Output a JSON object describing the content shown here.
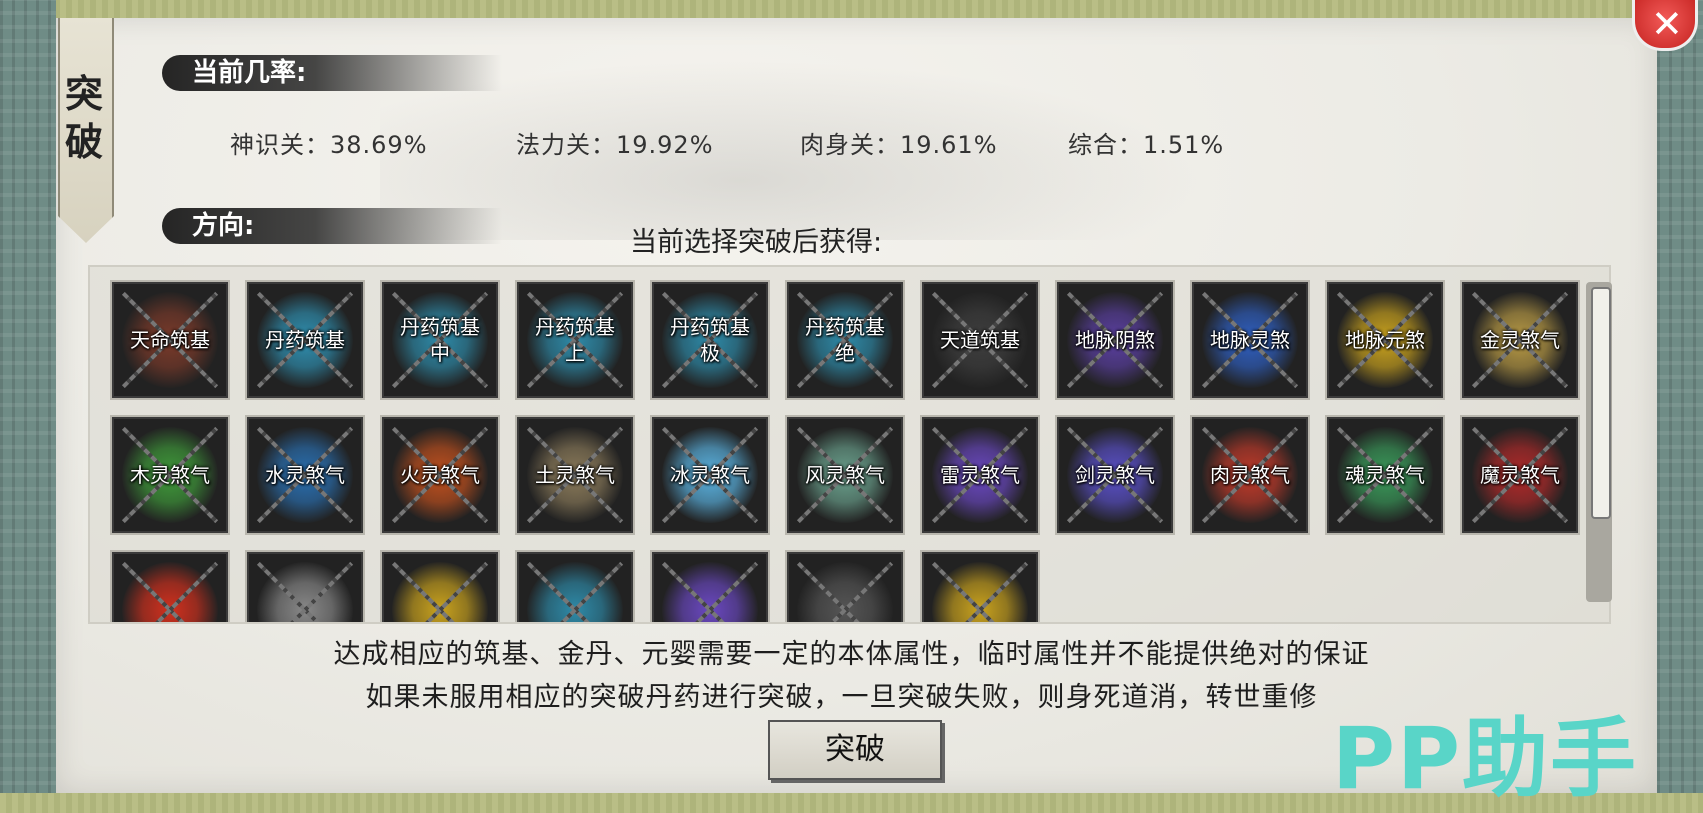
{
  "tab": {
    "label": "突\n破"
  },
  "probability_section": {
    "title": "当前几率:",
    "items": [
      {
        "text": "神识关：38.69%"
      },
      {
        "text": "法力关：19.92%"
      },
      {
        "text": "肉身关：19.61%"
      },
      {
        "text": "综合：1.51%"
      }
    ]
  },
  "direction_section": {
    "title": "方向:",
    "gain_title": "当前选择突破后获得:"
  },
  "items": [
    {
      "label": "天命筑基",
      "color": "#7a3a2a"
    },
    {
      "label": "丹药筑基",
      "color": "#2f8fb0"
    },
    {
      "label": "丹药筑基\n中",
      "color": "#2e8aa8"
    },
    {
      "label": "丹药筑基\n上",
      "color": "#2e8aa8"
    },
    {
      "label": "丹药筑基\n极",
      "color": "#2e8aa8"
    },
    {
      "label": "丹药筑基\n绝",
      "color": "#2e8aa8"
    },
    {
      "label": "天道筑基",
      "color": "#3e3e3e"
    },
    {
      "label": "地脉阴煞",
      "color": "#5a3fa0"
    },
    {
      "label": "地脉灵煞",
      "color": "#2f5fc0"
    },
    {
      "label": "地脉元煞",
      "color": "#c9a21e"
    },
    {
      "label": "金灵煞气",
      "color": "#b89a45"
    },
    {
      "label": "木灵煞气",
      "color": "#3f9a3a"
    },
    {
      "label": "水灵煞气",
      "color": "#2a6fb0"
    },
    {
      "label": "火灵煞气",
      "color": "#c0501e"
    },
    {
      "label": "土灵煞气",
      "color": "#8a7a5a"
    },
    {
      "label": "冰灵煞气",
      "color": "#5ab2e0"
    },
    {
      "label": "风灵煞气",
      "color": "#6aa08c"
    },
    {
      "label": "雷灵煞气",
      "color": "#6a48c0"
    },
    {
      "label": "剑灵煞气",
      "color": "#5a50c8"
    },
    {
      "label": "肉灵煞气",
      "color": "#c03a2a"
    },
    {
      "label": "魂灵煞气",
      "color": "#3a9a5a"
    },
    {
      "label": "魔灵煞气",
      "color": "#b02a2a"
    },
    {
      "label": "",
      "color": "#d0301e"
    },
    {
      "label": "",
      "color": "#888888"
    },
    {
      "label": "",
      "color": "#c9a21e"
    },
    {
      "label": "",
      "color": "#2e8aa8"
    },
    {
      "label": "",
      "color": "#6a48c0"
    },
    {
      "label": "",
      "color": "#555555"
    },
    {
      "label": "",
      "color": "#c9a21e"
    }
  ],
  "notice": {
    "line1": "达成相应的筑基、金丹、元婴需要一定的本体属性，临时属性并不能提供绝对的保证",
    "line2": "如果未服用相应的突破丹药进行突破，一旦突破失败，则身死道消，转世重修"
  },
  "break_button": {
    "label": "突破"
  },
  "close_button": {
    "icon": "close-icon"
  },
  "watermark": {
    "text": "PP助手"
  }
}
